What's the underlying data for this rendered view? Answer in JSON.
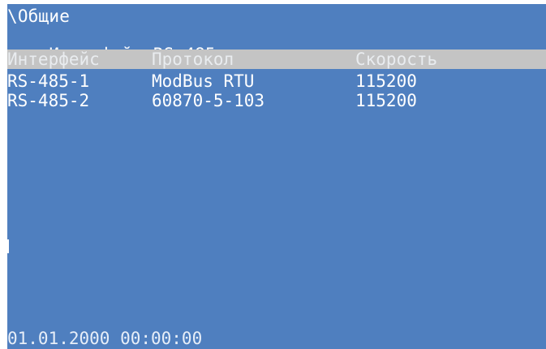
{
  "screen": {
    "breadcrumb": "\\Общие",
    "interface_prefix": "Интерфейс:",
    "interface_value": "RS-485",
    "columns": [
      "Интерфейс",
      "Протокол",
      "Скорость"
    ],
    "rows": [
      {
        "interface": "RS-485-1",
        "protocol": "ModBus RTU",
        "speed": "115200"
      },
      {
        "interface": "RS-485-2",
        "protocol": "60870-5-103",
        "speed": "115200"
      }
    ],
    "datetime": "01.01.2000 00:00:00"
  },
  "colors": {
    "background": "#4f7fbf",
    "text": "#ffffff",
    "header_highlight": "#c4c4c4"
  }
}
